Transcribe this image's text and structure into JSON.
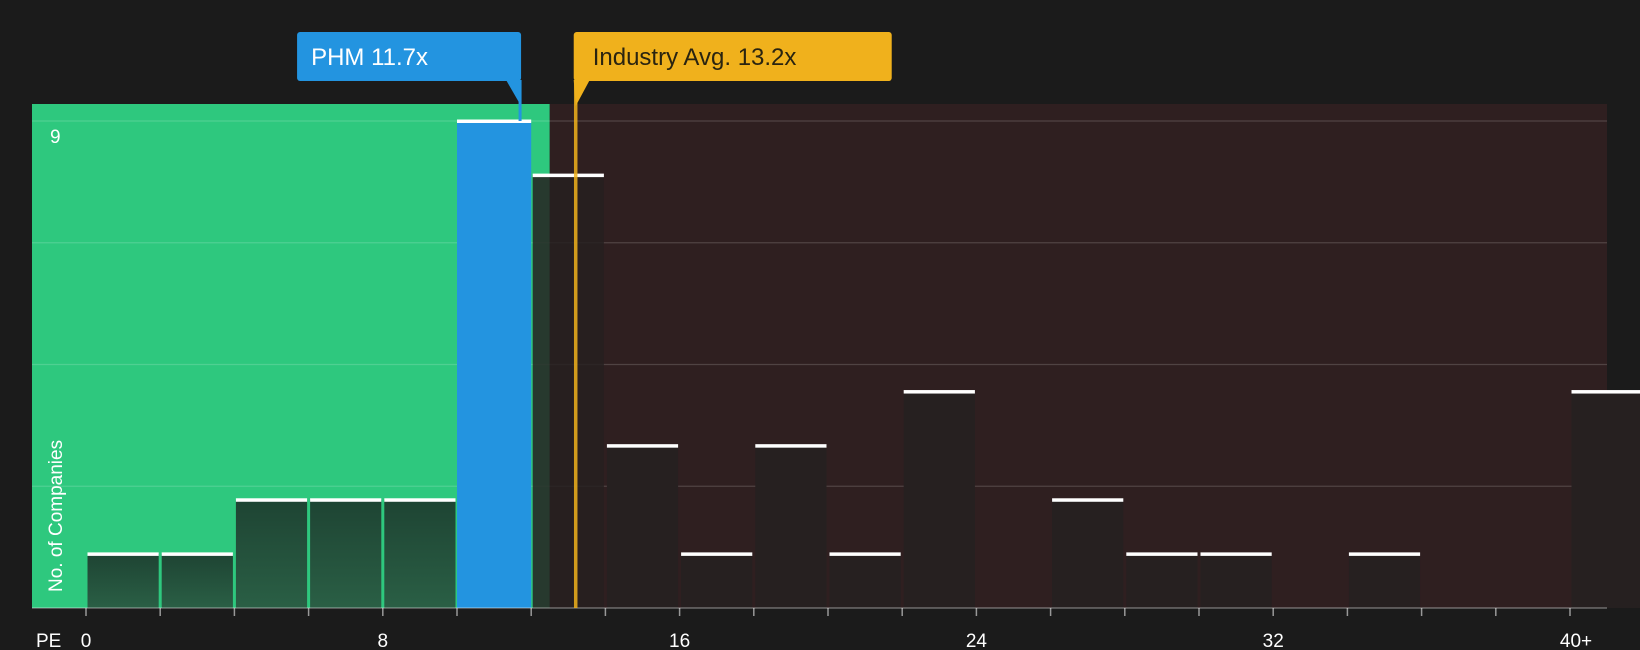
{
  "chart_data": {
    "type": "bar",
    "xlabel": "PE",
    "ylabel": "No. of Companies",
    "x_ticks": [
      "0",
      "8",
      "16",
      "24",
      "32",
      "40+"
    ],
    "y_ticks": [
      "9"
    ],
    "ylim": [
      0,
      9
    ],
    "xlim": [
      0,
      41
    ],
    "bin_width": 2,
    "bins": [
      {
        "start": 0,
        "count": 1
      },
      {
        "start": 2,
        "count": 1
      },
      {
        "start": 4,
        "count": 2
      },
      {
        "start": 6,
        "count": 2
      },
      {
        "start": 8,
        "count": 2
      },
      {
        "start": 10,
        "count": 9
      },
      {
        "start": 12,
        "count": 8
      },
      {
        "start": 14,
        "count": 3
      },
      {
        "start": 16,
        "count": 1
      },
      {
        "start": 18,
        "count": 3
      },
      {
        "start": 20,
        "count": 1
      },
      {
        "start": 22,
        "count": 4
      },
      {
        "start": 24,
        "count": 0
      },
      {
        "start": 26,
        "count": 2
      },
      {
        "start": 28,
        "count": 1
      },
      {
        "start": 30,
        "count": 1
      },
      {
        "start": 32,
        "count": 0
      },
      {
        "start": 34,
        "count": 1
      },
      {
        "start": 36,
        "count": 0
      },
      {
        "start": 38,
        "count": 0
      },
      {
        "start": 40,
        "count": 4
      }
    ],
    "highlight_bin_start": 10,
    "company": {
      "label": "PHM 11.7x",
      "value": 11.7
    },
    "industry": {
      "label": "Industry Avg. 13.2x",
      "value": 13.2
    },
    "good_region_end": 12.5,
    "colors": {
      "background": "#1b1b1b",
      "good_region": "#2ec87e",
      "bad_region": "#2f1f20",
      "company": "#2394e0",
      "industry": "#f0b11c",
      "bar_good": "#24513b",
      "bar_bad": "#262020",
      "cap": "#ffffff"
    }
  }
}
